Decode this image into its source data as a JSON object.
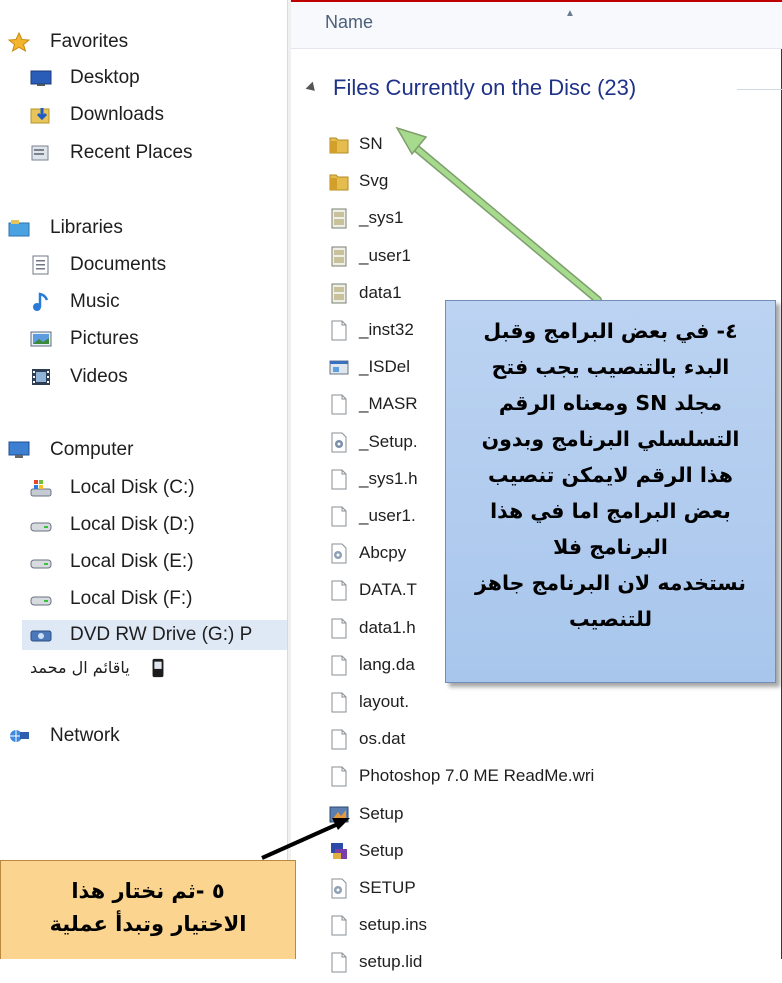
{
  "nav": {
    "items": [
      {
        "label": "Favorites",
        "icon": "star-icon"
      },
      {
        "label": "Desktop",
        "icon": "desktop-icon"
      },
      {
        "label": "Downloads",
        "icon": "downloads-icon"
      },
      {
        "label": "Recent Places",
        "icon": "recent-places-icon"
      },
      {
        "label": "Libraries",
        "icon": "libraries-icon"
      },
      {
        "label": "Documents",
        "icon": "documents-icon"
      },
      {
        "label": "Music",
        "icon": "music-icon"
      },
      {
        "label": "Pictures",
        "icon": "pictures-icon"
      },
      {
        "label": "Videos",
        "icon": "videos-icon"
      },
      {
        "label": "Computer",
        "icon": "computer-icon"
      },
      {
        "label": "Local Disk (C:)",
        "icon": "system-drive-icon"
      },
      {
        "label": "Local Disk (D:)",
        "icon": "drive-icon"
      },
      {
        "label": "Local Disk (E:)",
        "icon": "drive-icon"
      },
      {
        "label": "Local Disk (F:)",
        "icon": "drive-icon"
      },
      {
        "label": "DVD RW Drive (G:) P",
        "icon": "dvd-drive-icon"
      },
      {
        "label": "ياقائم ال محمد",
        "icon": "phone-icon"
      },
      {
        "label": "Network",
        "icon": "network-icon"
      }
    ]
  },
  "filelist": {
    "column_name": "Name",
    "group_title": "Files Currently on the Disc (23)",
    "files": [
      {
        "name": "SN",
        "icon": "folder-icon"
      },
      {
        "name": "Svg",
        "icon": "folder-icon"
      },
      {
        "name": "_sys1",
        "icon": "cab-file-icon"
      },
      {
        "name": "_user1",
        "icon": "cab-file-icon"
      },
      {
        "name": "data1",
        "icon": "cab-file-icon"
      },
      {
        "name": "_inst32",
        "icon": "blank-file-icon"
      },
      {
        "name": "_ISDel",
        "icon": "application-icon"
      },
      {
        "name": "_MASR",
        "icon": "blank-file-icon"
      },
      {
        "name": "_Setup.",
        "icon": "settings-file-icon"
      },
      {
        "name": "_sys1.h",
        "icon": "blank-file-icon"
      },
      {
        "name": "_user1.",
        "icon": "blank-file-icon"
      },
      {
        "name": "Abcpy",
        "icon": "config-file-icon"
      },
      {
        "name": "DATA.T",
        "icon": "blank-file-icon"
      },
      {
        "name": "data1.h",
        "icon": "blank-file-icon"
      },
      {
        "name": "lang.da",
        "icon": "blank-file-icon"
      },
      {
        "name": "layout.",
        "icon": "blank-file-icon"
      },
      {
        "name": "os.dat",
        "icon": "blank-file-icon"
      },
      {
        "name": "Photoshop 7.0 ME ReadMe.wri",
        "icon": "blank-file-icon"
      },
      {
        "name": "Setup",
        "icon": "photoshop-setup-icon"
      },
      {
        "name": "Setup",
        "icon": "installer-icon"
      },
      {
        "name": "SETUP",
        "icon": "config-file-icon"
      },
      {
        "name": "setup.ins",
        "icon": "blank-file-icon"
      },
      {
        "name": "setup.lid",
        "icon": "blank-file-icon"
      }
    ]
  },
  "callouts": {
    "main_lines": [
      "٤- في بعض البرامج وقبل",
      "البدء بالتنصيب يجب فتح",
      "مجلد SN ومعناه الرقم",
      "التسلسلي البرنامج وبدون",
      "هذا الرقم لايمكن تنصيب",
      "بعض البرامج اما في هذا",
      "البرنامج فلا",
      "نستخدمه لان البرنامج جاهز",
      "للتنصيب"
    ],
    "bottom_lines": [
      "٥ -ثم نختار هذا",
      "الاختيار وتبدأ عملية"
    ]
  },
  "colors": {
    "frame_border": "#c00000",
    "group_title": "#1e3287",
    "callout_main_bg": "#b4cdef",
    "callout_bottom_bg": "#fbd58f",
    "arrow_green": "#9fd389"
  }
}
